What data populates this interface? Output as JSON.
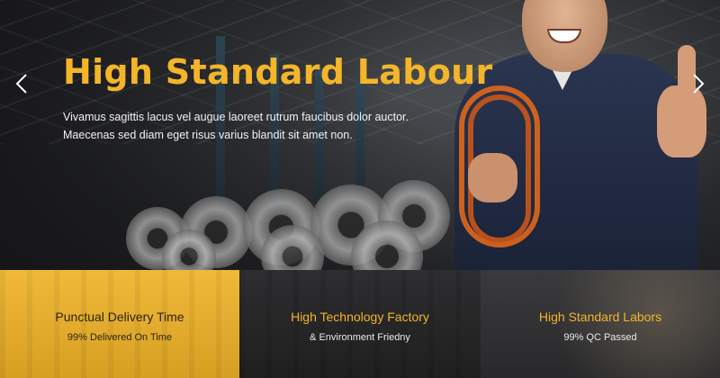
{
  "slider": {
    "title": "High Standard Labour",
    "description_lines": [
      "Vivamus sagittis lacus vel augue laoreet rutrum faucibus dolor auctor.",
      "Maecenas sed diam eget risus varius blandit sit amet non."
    ],
    "prev_icon": "chevron-left-icon",
    "next_icon": "chevron-right-icon"
  },
  "features": [
    {
      "title": "Punctual Delivery Time",
      "subtitle": "99% Delivered On Time"
    },
    {
      "title": "High Technology Factory",
      "subtitle": "& Environment Friedny"
    },
    {
      "title": "High Standard Labors",
      "subtitle": "99% QC Passed"
    }
  ],
  "colors": {
    "accent": "#f4b52a",
    "dark": "#1f1f20",
    "text_light": "#f2f2f2"
  }
}
